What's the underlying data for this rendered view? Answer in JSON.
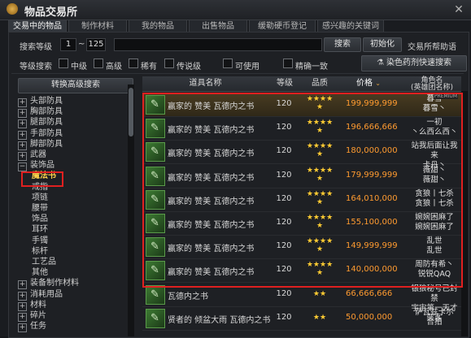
{
  "window": {
    "title": "物品交易所",
    "close": "✕"
  },
  "tabs": [
    "交易中的物品",
    "制作材料",
    "我的物品",
    "出售物品",
    "缓勒硬币登记",
    "感兴趣的关键词"
  ],
  "search": {
    "level_label": "搜索等级",
    "level_min": "1",
    "level_sep": "~",
    "level_max": "125",
    "search_button": "搜索",
    "reset_button": "初始化",
    "help_link": "交易所帮助语",
    "grade_label": "等级搜索",
    "grades": [
      "中级",
      "高级",
      "稀有",
      "传说级"
    ],
    "usable": "可使用",
    "exact": "精确一致",
    "dye_button": "染色药剂快速搜索"
  },
  "sidebar": {
    "toggle_button": "转换高级搜索",
    "items": [
      {
        "label": "头部防具",
        "type": "cat"
      },
      {
        "label": "胸部防具",
        "type": "cat"
      },
      {
        "label": "腿部防具",
        "type": "cat"
      },
      {
        "label": "手部防具",
        "type": "cat"
      },
      {
        "label": "脚部防具",
        "type": "cat"
      },
      {
        "label": "武器",
        "type": "cat"
      },
      {
        "label": "装饰品",
        "type": "cat"
      },
      {
        "label": "魔法书",
        "type": "sub",
        "selected": true
      },
      {
        "label": "戒指",
        "type": "sub"
      },
      {
        "label": "项链",
        "type": "sub"
      },
      {
        "label": "腰带",
        "type": "sub"
      },
      {
        "label": "饰品",
        "type": "sub"
      },
      {
        "label": "耳环",
        "type": "sub"
      },
      {
        "label": "手镯",
        "type": "sub"
      },
      {
        "label": "标杆",
        "type": "sub"
      },
      {
        "label": "工艺品",
        "type": "sub"
      },
      {
        "label": "其他",
        "type": "sub"
      },
      {
        "label": "装备制作材料",
        "type": "cat"
      },
      {
        "label": "消耗用品",
        "type": "cat"
      },
      {
        "label": "材料",
        "type": "cat"
      },
      {
        "label": "碎片",
        "type": "cat"
      },
      {
        "label": "任务",
        "type": "cat"
      }
    ]
  },
  "table": {
    "headers": [
      "道具名称",
      "等级",
      "品质",
      "价格",
      "角色名\n(英雄团名称)"
    ],
    "rows": [
      {
        "name": "赢家的 赞美 瓦德内之书",
        "level": "120",
        "stars": 5,
        "price": "199,999,999",
        "seller": [
          "暮雪",
          "暮雪丶"
        ],
        "selected": true,
        "badge": "PREMIUM"
      },
      {
        "name": "赢家的 赞美 瓦德内之书",
        "level": "120",
        "stars": 5,
        "price": "196,666,666",
        "seller": [
          "一初",
          "丶么西么西丶"
        ]
      },
      {
        "name": "赢家的 赞美 瓦德内之书",
        "level": "120",
        "stars": 5,
        "price": "180,000,000",
        "seller": [
          "站我后面让我来",
          "卡丹丶"
        ]
      },
      {
        "name": "赢家的 赞美 瓦德内之书",
        "level": "120",
        "stars": 5,
        "price": "179,999,999",
        "seller": [
          "薇甜丶",
          "薇甜丶"
        ]
      },
      {
        "name": "赢家的 赞美 瓦德内之书",
        "level": "120",
        "stars": 5,
        "price": "164,010,000",
        "seller": [
          "贪狼丨七杀",
          "贪狼丨七杀"
        ]
      },
      {
        "name": "赢家的 赞美 瓦德内之书",
        "level": "120",
        "stars": 5,
        "price": "155,100,000",
        "seller": [
          "婉婉困麻了",
          "婉婉困麻了"
        ]
      },
      {
        "name": "赢家的 赞美 瓦德内之书",
        "level": "120",
        "stars": 5,
        "price": "149,999,999",
        "seller": [
          "乱世",
          "乱世"
        ]
      },
      {
        "name": "赢家的 赞美 瓦德内之书",
        "level": "120",
        "stars": 5,
        "price": "140,000,000",
        "seller": [
          "周防有希丶",
          "锐锐QAQ"
        ]
      },
      {
        "name": "瓦德内之书",
        "level": "120",
        "stars": 2,
        "price": "66,666,666",
        "seller": [
          "银狼秘号已封禁",
          "宇宙第一天才骇客"
        ]
      },
      {
        "name": "贤者的 倾盆大雨 瓦德内之书",
        "level": "120",
        "stars": 2,
        "price": "50,000,000",
        "seller": [
          "萨瓦兹卡尔",
          "合拍"
        ]
      }
    ]
  },
  "colors": {
    "price": "#ff9b30",
    "stars": "#ffcc33",
    "highlight": "#e02020"
  }
}
